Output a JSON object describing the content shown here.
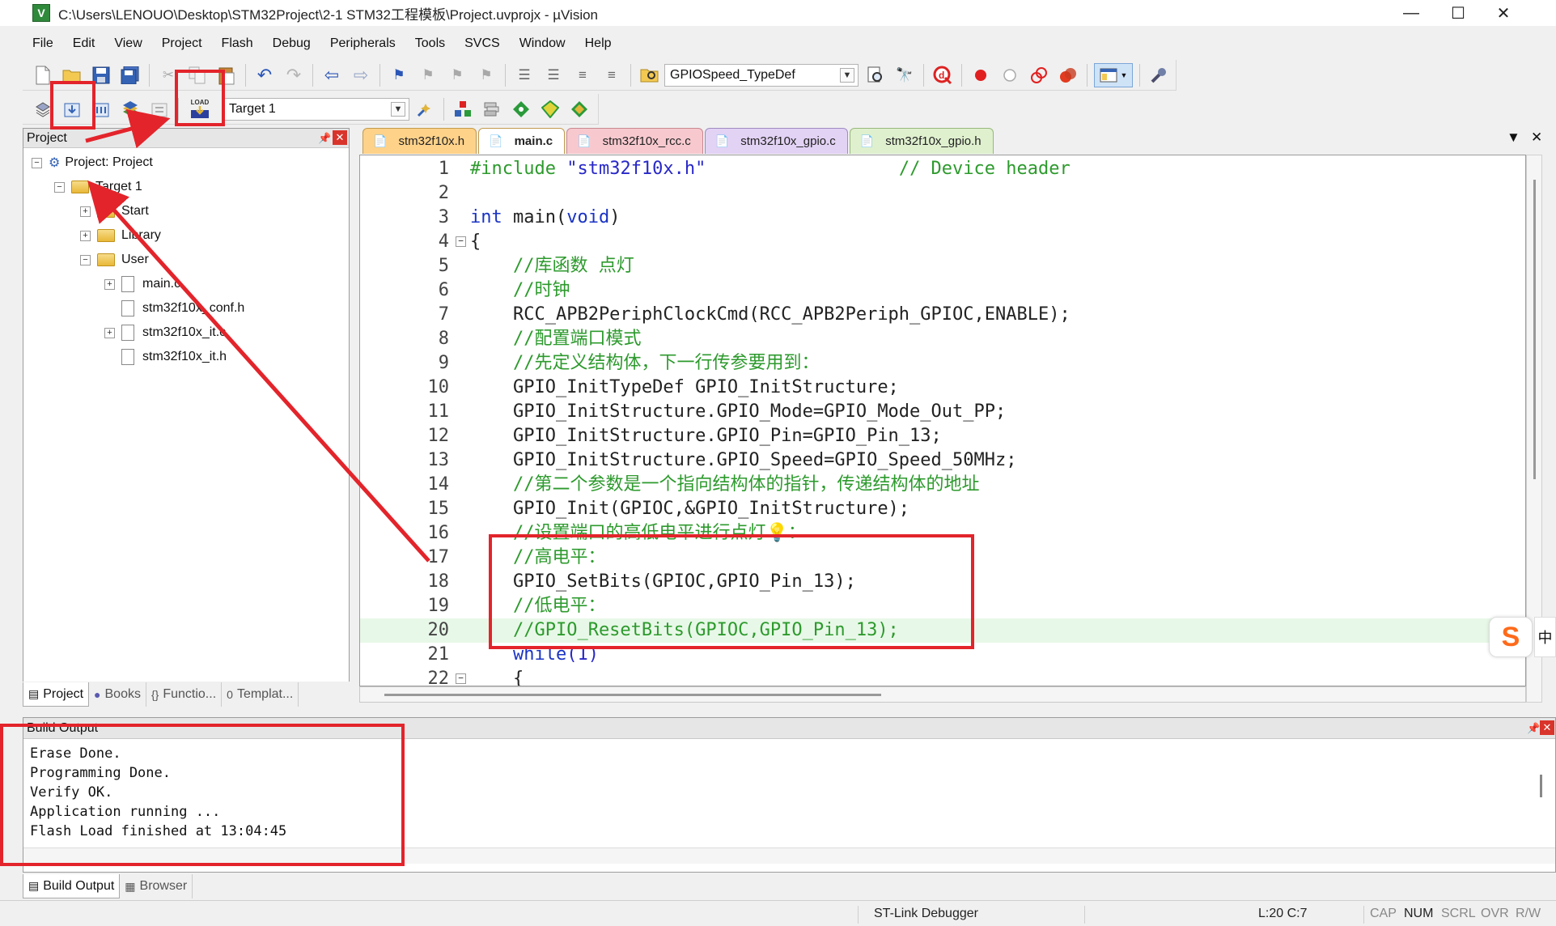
{
  "window": {
    "title": "C:\\Users\\LENOUO\\Desktop\\STM32Project\\2-1 STM32工程模板\\Project.uvprojx - µVision",
    "app_icon_letter": "V",
    "controls": {
      "minimize": "—",
      "maximize": "☐",
      "close": "✕"
    }
  },
  "menu": [
    "File",
    "Edit",
    "View",
    "Project",
    "Flash",
    "Debug",
    "Peripherals",
    "Tools",
    "SVCS",
    "Window",
    "Help"
  ],
  "toolbar": {
    "find_combo": "GPIOSpeed_TypeDef",
    "target_combo": "Target 1",
    "load_label": "LOAD"
  },
  "project_panel": {
    "title": "Project",
    "pin": "→",
    "close": "✕",
    "tree": {
      "root": "Project: Project",
      "target": "Target 1",
      "groups": [
        "Start",
        "Library",
        "User"
      ],
      "user_files": [
        "main.c",
        "stm32f10x_conf.h",
        "stm32f10x_it.c",
        "stm32f10x_it.h"
      ]
    },
    "tabs": [
      "Project",
      "Books",
      "Functio...",
      "Templat..."
    ]
  },
  "editor": {
    "tabs": [
      "stm32f10x.h",
      "main.c",
      "stm32f10x_rcc.c",
      "stm32f10x_gpio.c",
      "stm32f10x_gpio.h"
    ],
    "dropdown_arrow": "▼",
    "close": "✕",
    "lines": [
      {
        "n": "1",
        "parts": [
          {
            "t": "#include ",
            "c": "cm"
          },
          {
            "t": "\"stm32f10x.h\"",
            "c": "str"
          },
          {
            "t": "                  // Device header",
            "c": "cm"
          }
        ]
      },
      {
        "n": "2",
        "parts": []
      },
      {
        "n": "3",
        "parts": [
          {
            "t": "int ",
            "c": "kw"
          },
          {
            "t": "main",
            "c": "tx"
          },
          {
            "t": "(",
            "c": "tx"
          },
          {
            "t": "void",
            "c": "kw"
          },
          {
            "t": ")",
            "c": "tx"
          }
        ]
      },
      {
        "n": "4",
        "fold": "−",
        "parts": [
          {
            "t": "{",
            "c": "tx"
          }
        ]
      },
      {
        "n": "5",
        "parts": [
          {
            "t": "    //库函数 点灯",
            "c": "cm"
          }
        ]
      },
      {
        "n": "6",
        "parts": [
          {
            "t": "    //时钟",
            "c": "cm"
          }
        ]
      },
      {
        "n": "7",
        "parts": [
          {
            "t": "    RCC_APB2PeriphClockCmd(RCC_APB2Periph_GPIOC,ENABLE);",
            "c": "tx"
          }
        ]
      },
      {
        "n": "8",
        "parts": [
          {
            "t": "    //配置端口模式",
            "c": "cm"
          }
        ]
      },
      {
        "n": "9",
        "parts": [
          {
            "t": "    //先定义结构体，下一行传参要用到：",
            "c": "cm"
          }
        ]
      },
      {
        "n": "10",
        "parts": [
          {
            "t": "    GPIO_InitTypeDef GPIO_InitStructure;",
            "c": "tx"
          }
        ]
      },
      {
        "n": "11",
        "parts": [
          {
            "t": "    GPIO_InitStructure.GPIO_Mode=GPIO_Mode_Out_PP;",
            "c": "tx"
          }
        ]
      },
      {
        "n": "12",
        "parts": [
          {
            "t": "    GPIO_InitStructure.GPIO_Pin=GPIO_Pin_13;",
            "c": "tx"
          }
        ]
      },
      {
        "n": "13",
        "parts": [
          {
            "t": "    GPIO_InitStructure.GPIO_Speed=GPIO_Speed_50MHz;",
            "c": "tx"
          }
        ]
      },
      {
        "n": "14",
        "parts": [
          {
            "t": "    //第二个参数是一个指向结构体的指针，传递结构体的地址",
            "c": "cm"
          }
        ]
      },
      {
        "n": "15",
        "parts": [
          {
            "t": "    GPIO_Init(GPIOC,&GPIO_InitStructure);",
            "c": "tx"
          }
        ]
      },
      {
        "n": "16",
        "parts": [
          {
            "t": "    //设置端口的高低电平进行点灯💡：",
            "c": "cm"
          }
        ]
      },
      {
        "n": "17",
        "parts": [
          {
            "t": "    //高电平：",
            "c": "cm"
          }
        ]
      },
      {
        "n": "18",
        "parts": [
          {
            "t": "    GPIO_SetBits(GPIOC,GPIO_Pin_13);",
            "c": "tx"
          }
        ]
      },
      {
        "n": "19",
        "parts": [
          {
            "t": "    //低电平：",
            "c": "cm"
          }
        ]
      },
      {
        "n": "20",
        "hl": true,
        "parts": [
          {
            "t": "    //GPIO_ResetBits(GPIOC,GPIO_Pin_13);",
            "c": "cm"
          }
        ]
      },
      {
        "n": "21",
        "parts": [
          {
            "t": "    ",
            "c": "tx"
          },
          {
            "t": "while",
            "c": "kw"
          },
          {
            "t": "(1)",
            "c": "str"
          }
        ]
      },
      {
        "n": "22",
        "fold": "−",
        "parts": [
          {
            "t": "    {",
            "c": "tx"
          }
        ]
      }
    ]
  },
  "build_output": {
    "title": "Build Output",
    "lines": [
      "Erase Done.",
      "Programming Done.",
      "Verify OK.",
      "Application running ...",
      "Flash Load finished at 13:04:45"
    ],
    "tabs": [
      "Build Output",
      "Browser"
    ]
  },
  "status_bar": {
    "debugger": "ST-Link Debugger",
    "position": "L:20 C:7",
    "cap": "CAP",
    "num": "NUM",
    "scrl": "SCRL",
    "ovr": "OVR",
    "rw": "R/W"
  },
  "colors": {
    "annotation_red": "#e3242b",
    "comment_green": "#2d9a2d",
    "keyword_blue": "#1a33c4",
    "current_line_bg": "#e8f8e8"
  },
  "side_widget": {
    "glyph": "S",
    "edge": "中"
  }
}
